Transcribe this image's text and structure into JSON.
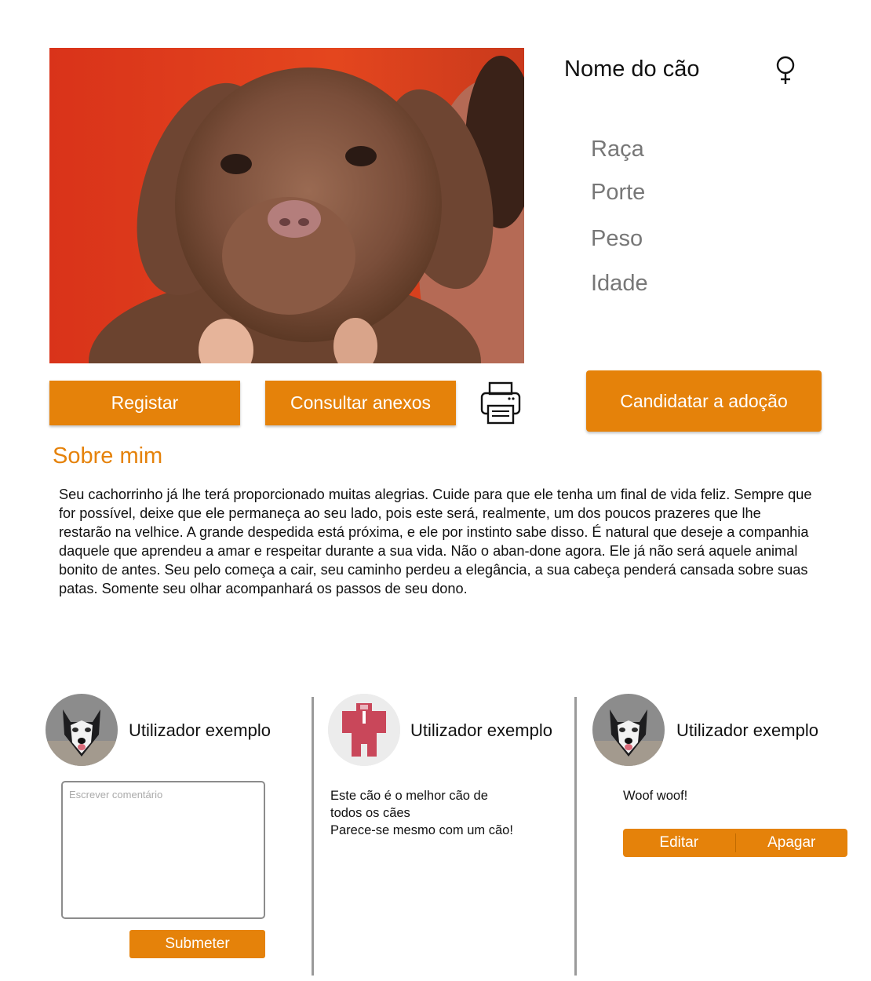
{
  "dog": {
    "name": "Nome do cão",
    "gender_icon": "female-icon",
    "attributes": [
      "Raça",
      "Porte",
      "Peso",
      "Idade"
    ]
  },
  "actions": {
    "register_label": "Registar",
    "attachments_label": "Consultar anexos",
    "print_icon": "printer-icon",
    "adopt_label": "Candidatar a adoção"
  },
  "about": {
    "title": "Sobre mim",
    "text": "Seu cachorrinho já lhe terá proporcionado muitas alegrias. Cuide para que ele tenha um final de vida feliz. Sempre que for possível, deixe que ele permaneça ao seu lado, pois este será, realmente, um dos poucos prazeres que lhe restarão na velhice. A grande despedida está próxima, e ele por instinto sabe disso. É natural que deseje a companhia daquele que aprendeu a amar e respeitar durante a sua vida. Não o aban-done agora. Ele já não será aquele animal bonito de antes. Seu pelo começa a cair, seu caminho perdeu a elegância, a sua cabeça penderá cansada sobre suas patas. Somente seu olhar acompanhará os passos de seu dono."
  },
  "comments": {
    "new": {
      "user": "Utilizador exemplo",
      "placeholder": "Escrever comentário",
      "submit_label": "Submeter"
    },
    "items": [
      {
        "user": "Utilizador exemplo",
        "lines": [
          "Este cão é o melhor cão de",
          "todos os cães",
          "Parece-se mesmo com um cão!"
        ]
      },
      {
        "user": "Utilizador exemplo",
        "lines": [
          "Woof woof!"
        ],
        "edit_label": "Editar",
        "delete_label": "Apagar"
      }
    ]
  },
  "colors": {
    "accent": "#e5820a",
    "divider": "#9a9a9a",
    "attribute_text": "#777777"
  }
}
